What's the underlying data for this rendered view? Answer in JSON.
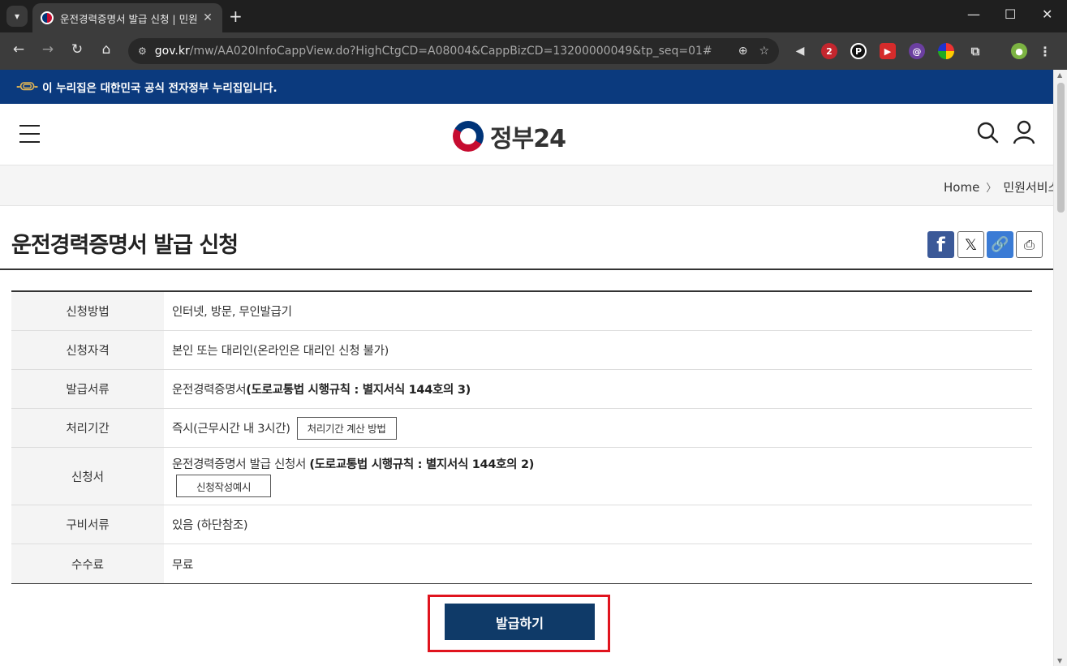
{
  "browser": {
    "tab_title": "운전경력증명서 발급 신청 | 민원",
    "url_host": "gov.kr",
    "url_path": "/mw/AA020InfoCappView.do?HighCtgCD=A08004&CappBizCD=13200000049&tp_seq=01#",
    "ext_badge": "2"
  },
  "gov_banner": {
    "text": "이 누리집은 대한민국 공식 전자정부 누리집입니다."
  },
  "header": {
    "logo_text": "정부24"
  },
  "breadcrumb": {
    "home": "Home",
    "current": "민원서비스"
  },
  "page": {
    "title": "운전경력증명서 발급 신청"
  },
  "info_rows": {
    "method": {
      "label": "신청방법",
      "value": "인터넷, 방문, 무인발급기"
    },
    "eligibility": {
      "label": "신청자격",
      "value": "본인 또는 대리인(온라인은 대리인 신청 불가)"
    },
    "document": {
      "label": "발급서류",
      "value": "운전경력증명서 ",
      "value_bold": "(도로교통법 시행규칙 : 별지서식 144호의 3)"
    },
    "period": {
      "label": "처리기간",
      "value": "즉시(근무시간 내 3시간)",
      "button": "처리기간 계산 방법"
    },
    "form": {
      "label": "신청서",
      "value": "운전경력증명서 발급 신청서 ",
      "value_bold": "(도로교통법 시행규칙 : 별지서식 144호의 2)",
      "button": "신청작성예시"
    },
    "required": {
      "label": "구비서류",
      "value": "있음 (하단참조)"
    },
    "fee": {
      "label": "수수료",
      "value": "무료"
    }
  },
  "actions": {
    "issue_label": "발급하기"
  },
  "colors": {
    "gov_blue": "#0b3a7e",
    "button_navy": "#0f3a68",
    "highlight_red": "#e0141e"
  }
}
